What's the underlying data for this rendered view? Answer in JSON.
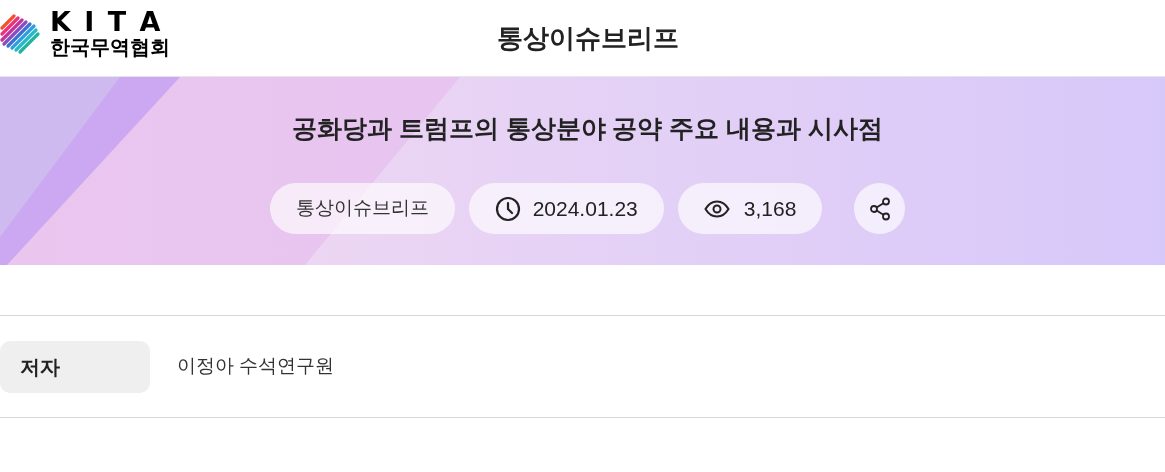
{
  "header": {
    "logo": {
      "letters": "K I T A",
      "name": "한국무역협회"
    },
    "title": "통상이슈브리프"
  },
  "article": {
    "title": "공화당과 트럼프의 통상분야 공약 주요 내용과 시사점",
    "category": "통상이슈브리프",
    "date": "2024.01.23",
    "views": "3,168"
  },
  "info": [
    {
      "label": "저자",
      "value": "이정아 수석연구원"
    }
  ]
}
